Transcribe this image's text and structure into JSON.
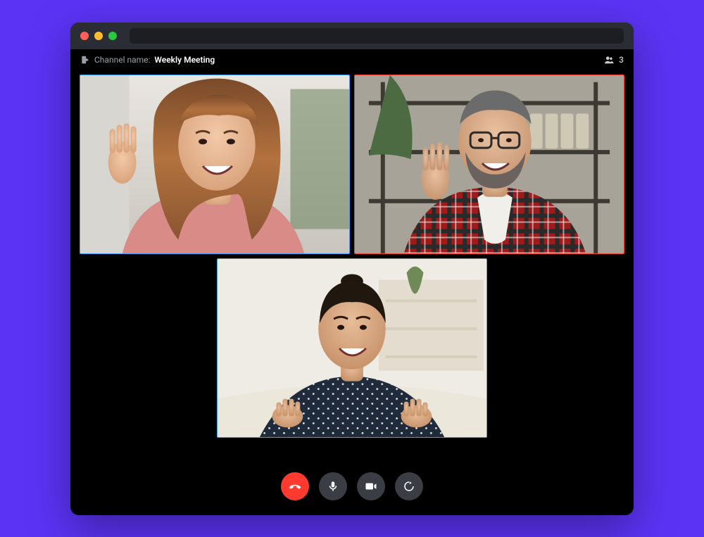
{
  "header": {
    "channel_label": "Channel name:",
    "channel_name": "Weekly Meeting",
    "participant_count": "3"
  },
  "participants": [
    {
      "border": "normal"
    },
    {
      "border": "active"
    },
    {
      "border": "normal"
    }
  ],
  "controls": {
    "end_call": "End call",
    "mic": "Microphone",
    "camera": "Camera",
    "share": "Screen share"
  },
  "colors": {
    "page_bg": "#5b33f5",
    "window_bg": "#000000",
    "titlebar_bg": "#2a2d33",
    "tile_border": "#3aa0ff",
    "tile_border_active": "#ff3b30",
    "end_call_btn": "#ff3b30",
    "control_btn": "#3a3d44"
  }
}
